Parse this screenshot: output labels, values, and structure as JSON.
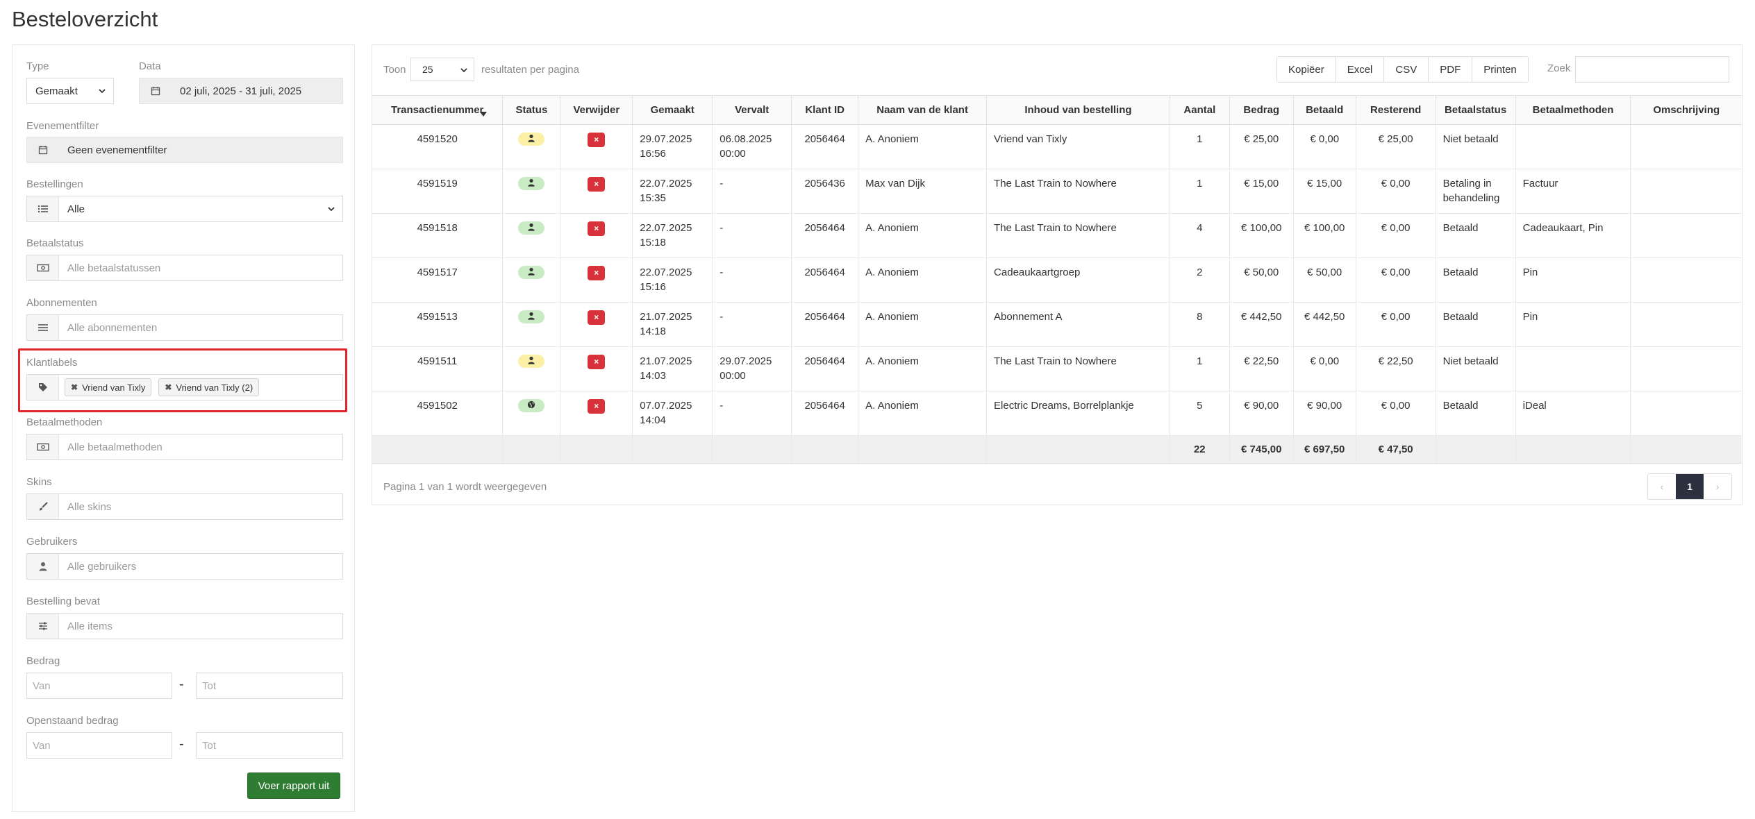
{
  "page": {
    "title": "Besteloverzicht"
  },
  "filters": {
    "type_label": "Type",
    "type_value": "Gemaakt",
    "date_label": "Data",
    "date_value": "02 juli, 2025 - 31 juli, 2025",
    "event_label": "Evenementfilter",
    "event_value": "Geen evenementfilter",
    "orders_label": "Bestellingen",
    "orders_value": "Alle",
    "paystatus_label": "Betaalstatus",
    "paystatus_placeholder": "Alle betaalstatussen",
    "subscriptions_label": "Abonnementen",
    "subscriptions_placeholder": "Alle abonnementen",
    "customer_labels_label": "Klantlabels",
    "customer_labels_tags": [
      "Vriend van Tixly",
      "Vriend van Tixly (2)"
    ],
    "paymethods_label": "Betaalmethoden",
    "paymethods_placeholder": "Alle betaalmethoden",
    "skins_label": "Skins",
    "skins_placeholder": "Alle skins",
    "users_label": "Gebruikers",
    "users_placeholder": "Alle gebruikers",
    "contains_label": "Bestelling bevat",
    "contains_placeholder": "Alle items",
    "amount_label": "Bedrag",
    "amount_from_placeholder": "Van",
    "amount_to_placeholder": "Tot",
    "open_amount_label": "Openstaand bedrag",
    "open_from_placeholder": "Van",
    "open_to_placeholder": "Tot",
    "dash": "-",
    "run_button": "Voer rapport uit"
  },
  "results": {
    "show_label": "Toon",
    "per_page_value": "25",
    "per_page_suffix": "resultaten per pagina",
    "export_buttons": [
      "Kopiëer",
      "Excel",
      "CSV",
      "PDF",
      "Printen"
    ],
    "search_label": "Zoek",
    "columns": [
      "Transactienummer",
      "Status",
      "Verwijder",
      "Gemaakt",
      "Vervalt",
      "Klant ID",
      "Naam van de klant",
      "Inhoud van bestelling",
      "Aantal",
      "Bedrag",
      "Betaald",
      "Resterend",
      "Betaalstatus",
      "Betaalmethoden",
      "Omschrijving"
    ],
    "rows": [
      {
        "id": "4591520",
        "status": "yellow",
        "status_icon": "person-icon",
        "created": [
          "29.07.2025",
          "16:56"
        ],
        "expires": [
          "06.08.2025",
          "00:00"
        ],
        "customer_id": "2056464",
        "customer_name": "A. Anoniem",
        "content": "Vriend van Tixly",
        "qty": "1",
        "amount": "€ 25,00",
        "paid": "€ 0,00",
        "remaining": "€ 25,00",
        "pay_status": "Niet betaald",
        "pay_methods": "",
        "description": ""
      },
      {
        "id": "4591519",
        "status": "green",
        "status_icon": "person-icon",
        "created": [
          "22.07.2025",
          "15:35"
        ],
        "expires": [
          "-",
          ""
        ],
        "customer_id": "2056436",
        "customer_name": "Max van Dijk",
        "content": "The Last Train to Nowhere",
        "qty": "1",
        "amount": "€ 15,00",
        "paid": "€ 15,00",
        "remaining": "€ 0,00",
        "pay_status": "Betaling in behandeling",
        "pay_methods": "Factuur",
        "description": ""
      },
      {
        "id": "4591518",
        "status": "green",
        "status_icon": "person-icon",
        "created": [
          "22.07.2025",
          "15:18"
        ],
        "expires": [
          "-",
          ""
        ],
        "customer_id": "2056464",
        "customer_name": "A. Anoniem",
        "content": "The Last Train to Nowhere",
        "qty": "4",
        "amount": "€ 100,00",
        "paid": "€ 100,00",
        "remaining": "€ 0,00",
        "pay_status": "Betaald",
        "pay_methods": "Cadeaukaart, Pin",
        "description": ""
      },
      {
        "id": "4591517",
        "status": "green",
        "status_icon": "person-icon",
        "created": [
          "22.07.2025",
          "15:16"
        ],
        "expires": [
          "-",
          ""
        ],
        "customer_id": "2056464",
        "customer_name": "A. Anoniem",
        "content": "Cadeaukaartgroep",
        "qty": "2",
        "amount": "€ 50,00",
        "paid": "€ 50,00",
        "remaining": "€ 0,00",
        "pay_status": "Betaald",
        "pay_methods": "Pin",
        "description": ""
      },
      {
        "id": "4591513",
        "status": "green",
        "status_icon": "person-icon",
        "created": [
          "21.07.2025",
          "14:18"
        ],
        "expires": [
          "-",
          ""
        ],
        "customer_id": "2056464",
        "customer_name": "A. Anoniem",
        "content": "Abonnement A",
        "qty": "8",
        "amount": "€ 442,50",
        "paid": "€ 442,50",
        "remaining": "€ 0,00",
        "pay_status": "Betaald",
        "pay_methods": "Pin",
        "description": ""
      },
      {
        "id": "4591511",
        "status": "yellow",
        "status_icon": "person-icon",
        "created": [
          "21.07.2025",
          "14:03"
        ],
        "expires": [
          "29.07.2025",
          "00:00"
        ],
        "customer_id": "2056464",
        "customer_name": "A. Anoniem",
        "content": "The Last Train to Nowhere",
        "qty": "1",
        "amount": "€ 22,50",
        "paid": "€ 0,00",
        "remaining": "€ 22,50",
        "pay_status": "Niet betaald",
        "pay_methods": "",
        "description": ""
      },
      {
        "id": "4591502",
        "status": "green",
        "status_icon": "globe-icon",
        "created": [
          "07.07.2025",
          "14:04"
        ],
        "expires": [
          "-",
          ""
        ],
        "customer_id": "2056464",
        "customer_name": "A. Anoniem",
        "content": "Electric Dreams, Borrelplankje",
        "qty": "5",
        "amount": "€ 90,00",
        "paid": "€ 90,00",
        "remaining": "€ 0,00",
        "pay_status": "Betaald",
        "pay_methods": "iDeal",
        "description": ""
      }
    ],
    "delete_glyph": "×",
    "totals": {
      "qty": "22",
      "amount": "€ 745,00",
      "paid": "€ 697,50",
      "remaining": "€ 47,50"
    },
    "footer_info": "Pagina 1 van 1 wordt weergegeven",
    "pager": {
      "prev": "‹",
      "current": "1",
      "next": "›"
    }
  },
  "colors": {
    "run_button": "#2e7d32",
    "highlight": "#e0262c",
    "delete": "#d8323c",
    "status_yellow": "#fcefa6",
    "status_green": "#c8ebc4",
    "pager_active": "#2b313f"
  }
}
